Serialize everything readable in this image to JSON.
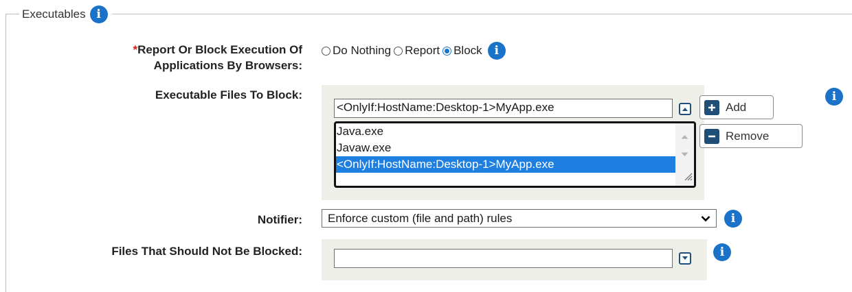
{
  "section": {
    "title": "Executables"
  },
  "report_block": {
    "label_line1": "Report Or Block Execution Of",
    "label_line2": "Applications By Browsers:",
    "required_mark": "*",
    "options": [
      "Do Nothing",
      "Report",
      "Block"
    ],
    "selected": "Block"
  },
  "files_to_block": {
    "label": "Executable Files To Block:",
    "input_value": "<OnlyIf:HostName:Desktop-1>MyApp.exe",
    "add_label": "Add",
    "remove_label": "Remove",
    "items": [
      "Java.exe",
      "Javaw.exe",
      "<OnlyIf:HostName:Desktop-1>MyApp.exe"
    ],
    "selected_index": 2
  },
  "notifier": {
    "label": "Notifier:",
    "selected_value": "Enforce custom (file and path) rules"
  },
  "not_blocked": {
    "label": "Files That Should Not Be Blocked:",
    "input_value": ""
  },
  "icons": {
    "info": "info-icon",
    "add": "plus-icon",
    "remove": "minus-icon",
    "collapse": "chevron-up-icon",
    "expand": "chevron-down-icon",
    "dropdown": "chevron-down-icon"
  },
  "colors": {
    "accent": "#1a73c8",
    "button_icon": "#1f4e79",
    "selection": "#1e7fe0",
    "required": "#d02020",
    "panel": "#efefe9"
  }
}
